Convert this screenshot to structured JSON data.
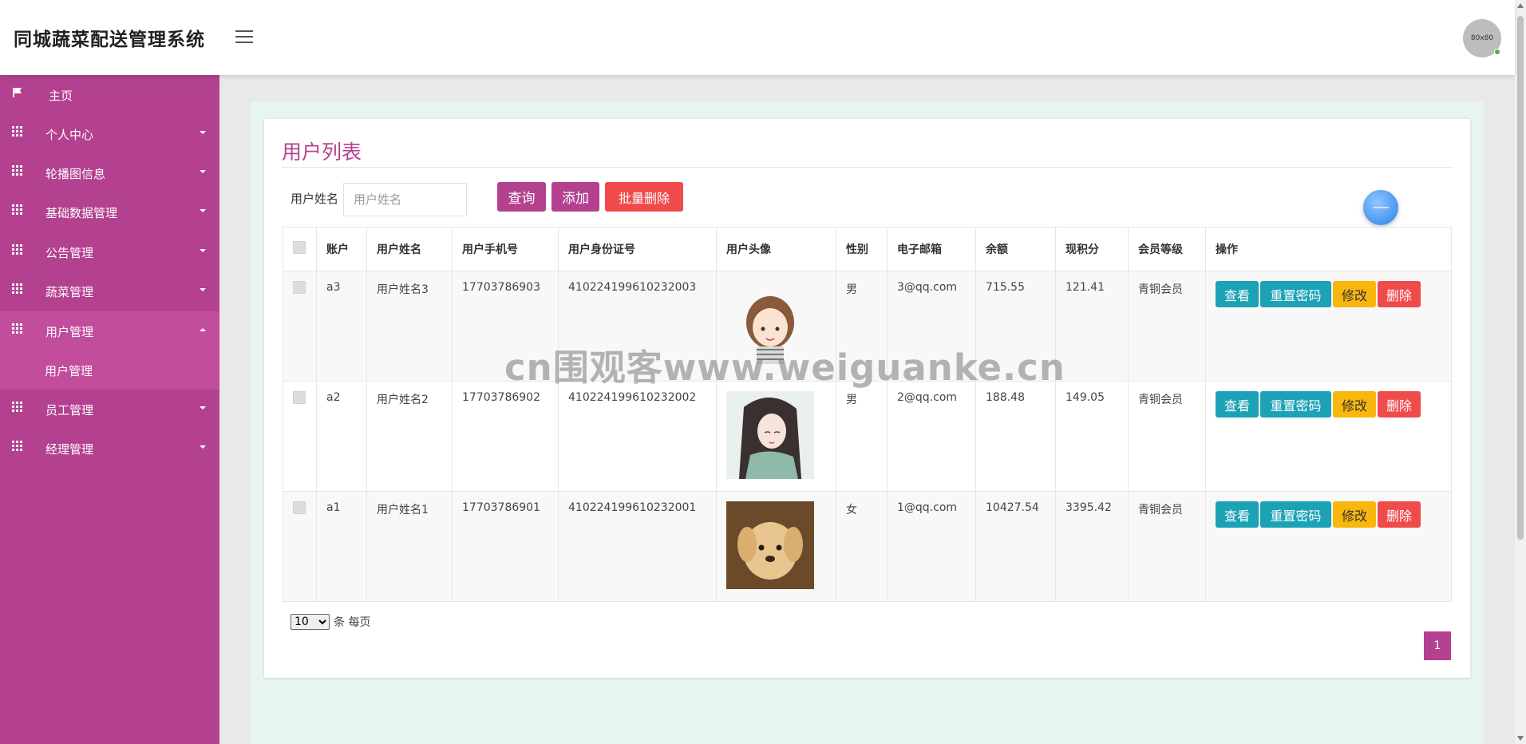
{
  "header": {
    "brand": "同城蔬菜配送管理系统",
    "avatar_text": "80x80"
  },
  "sidebar": {
    "items": [
      {
        "label": "主页",
        "icon": "flag-icon"
      },
      {
        "label": "个人中心",
        "icon": "grid-icon"
      },
      {
        "label": "轮播图信息",
        "icon": "grid-icon"
      },
      {
        "label": "基础数据管理",
        "icon": "grid-icon"
      },
      {
        "label": "公告管理",
        "icon": "grid-icon"
      },
      {
        "label": "蔬菜管理",
        "icon": "grid-icon"
      },
      {
        "label": "用户管理",
        "icon": "grid-icon"
      },
      {
        "label": "员工管理",
        "icon": "grid-icon"
      },
      {
        "label": "经理管理",
        "icon": "grid-icon"
      }
    ],
    "active_sub": "用户管理"
  },
  "main": {
    "title": "用户列表",
    "search": {
      "label": "用户姓名",
      "placeholder": "用户姓名",
      "value": ""
    },
    "buttons": {
      "query": "查询",
      "add": "添加",
      "batch_delete": "批量删除"
    },
    "table": {
      "columns": [
        "账户",
        "用户姓名",
        "用户手机号",
        "用户身份证号",
        "用户头像",
        "性别",
        "电子邮箱",
        "余额",
        "现积分",
        "会员等级",
        "操作"
      ],
      "rows": [
        {
          "account": "a3",
          "name": "用户姓名3",
          "phone": "17703786903",
          "id_card": "410224199610232003",
          "avatar": "cartoon-girl",
          "gender": "男",
          "email": "3@qq.com",
          "balance": "715.55",
          "points": "121.41",
          "level": "青铜会员"
        },
        {
          "account": "a2",
          "name": "用户姓名2",
          "phone": "17703786902",
          "id_card": "410224199610232002",
          "avatar": "anime-girl",
          "gender": "男",
          "email": "2@qq.com",
          "balance": "188.48",
          "points": "149.05",
          "level": "青铜会员"
        },
        {
          "account": "a1",
          "name": "用户姓名1",
          "phone": "17703786901",
          "id_card": "410224199610232001",
          "avatar": "puppy",
          "gender": "女",
          "email": "1@qq.com",
          "balance": "10427.54",
          "points": "3395.42",
          "level": "青铜会员"
        }
      ],
      "actions": {
        "view": "查看",
        "reset": "重置密码",
        "edit": "修改",
        "delete": "删除"
      }
    },
    "pagination": {
      "page_size": "10",
      "page_size_suffix": "条 每页",
      "current_page": "1"
    }
  },
  "watermark": "cn围观客www.weiguanke.cn",
  "colors": {
    "brand": "#b3418f",
    "danger": "#f04b4b",
    "info": "#1ca2b5",
    "warning": "#f9b70d"
  }
}
